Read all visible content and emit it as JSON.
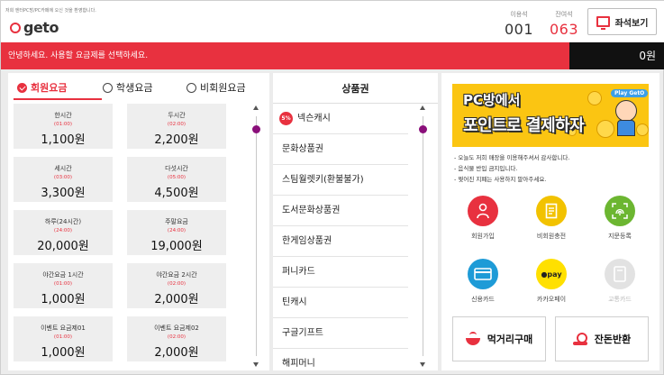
{
  "header": {
    "welcome_text": "저희 엔터PC방/PC카페에 오신 것을 환영합니다.",
    "logo_text": "geto",
    "used_seats_label": "이용석",
    "used_seats_value": "001",
    "remaining_seats_label": "잔여석",
    "remaining_seats_value": "063",
    "seat_view_button": "좌석보기"
  },
  "notice": {
    "message": "안녕하세요. 사용할 요금제를 선택하세요.",
    "balance": "0원"
  },
  "rate_tabs": [
    {
      "label": "회원요금",
      "selected": true
    },
    {
      "label": "학생요금",
      "selected": false
    },
    {
      "label": "비회원요금",
      "selected": false
    }
  ],
  "rates": [
    {
      "name": "한시간",
      "time": "(01:00)",
      "price": "1,100원"
    },
    {
      "name": "두시간",
      "time": "(02:00)",
      "price": "2,200원"
    },
    {
      "name": "세시간",
      "time": "(03:00)",
      "price": "3,300원"
    },
    {
      "name": "다섯시간",
      "time": "(05:00)",
      "price": "4,500원"
    },
    {
      "name": "하루(24시간)",
      "time": "(24:00)",
      "price": "20,000원"
    },
    {
      "name": "주말요금",
      "time": "(24:00)",
      "price": "19,000원"
    },
    {
      "name": "야간요금 1시간",
      "time": "(01:00)",
      "price": "1,000원"
    },
    {
      "name": "야간요금 2시간",
      "time": "(02:00)",
      "price": "2,000원"
    },
    {
      "name": "이벤트 요금제01",
      "time": "(01:00)",
      "price": "1,000원"
    },
    {
      "name": "이벤트 요금제02",
      "time": "(02:00)",
      "price": "2,000원"
    }
  ],
  "products": {
    "title": "상품권",
    "items": [
      {
        "label": "넥슨캐시",
        "badge": "5%"
      },
      {
        "label": "문화상품권",
        "badge": ""
      },
      {
        "label": "스팀월렛키(환불불가)",
        "badge": ""
      },
      {
        "label": "도서문화상품권",
        "badge": ""
      },
      {
        "label": "한게임상품권",
        "badge": ""
      },
      {
        "label": "퍼니카드",
        "badge": ""
      },
      {
        "label": "틴캐시",
        "badge": ""
      },
      {
        "label": "구글기프트",
        "badge": ""
      },
      {
        "label": "해피머니",
        "badge": ""
      }
    ]
  },
  "banner": {
    "line1": "PC방에서",
    "line2": "포인트로 결제하자",
    "tag": "Play GetO"
  },
  "notes": [
    "- 오늘도 저희 매장을 이용해주셔서 감사합니다.",
    "- 음식물 반입 금지입니다.",
    "- 찢어진 지폐는 사용하지 말아주세요."
  ],
  "actions": [
    {
      "label": "회원가입",
      "icon": "person-icon",
      "color": "#e8313f",
      "enabled": true
    },
    {
      "label": "비회원충전",
      "icon": "receipt-icon",
      "color": "#f2c200",
      "enabled": true
    },
    {
      "label": "지문등록",
      "icon": "fingerprint-icon",
      "color": "#6cb631",
      "enabled": true
    },
    {
      "label": "신용카드",
      "icon": "card-icon",
      "color": "#1e9bd7",
      "enabled": true
    },
    {
      "label": "카카오페이",
      "icon": "kakaopay-icon",
      "color": "#ffe000",
      "enabled": true
    },
    {
      "label": "교통카드",
      "icon": "transit-card-icon",
      "color": "#e2e2e2",
      "enabled": false
    }
  ],
  "bottom_buttons": {
    "food": "먹거리구매",
    "refund": "잔돈반환"
  },
  "colors": {
    "accent": "#e8313f",
    "scroll_thumb": "#8a0f7a"
  }
}
